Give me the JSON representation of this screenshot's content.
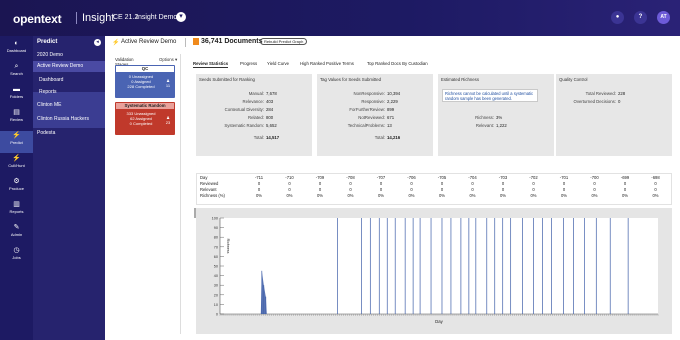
{
  "header": {
    "logo": "opentext",
    "product": "Insight",
    "version": "CE 21.2",
    "case_name": "Insight Demo",
    "chevron": "▾",
    "bell_icon": "●",
    "help_icon": "?",
    "avatar_initials": "AT"
  },
  "rail": [
    {
      "icon": "dashboard-icon",
      "glyph": "◐",
      "label": "Dashboard"
    },
    {
      "icon": "search-icon",
      "glyph": "⌕",
      "label": "Search"
    },
    {
      "icon": "folder-icon",
      "glyph": "▬",
      "label": "Folders"
    },
    {
      "icon": "review-icon",
      "glyph": "▤",
      "label": "Review"
    },
    {
      "icon": "predict-icon",
      "glyph": "⚡",
      "label": "Predict"
    },
    {
      "icon": "cull-icon",
      "glyph": "⚡",
      "label": "Cull/Hunt"
    },
    {
      "icon": "produce-icon",
      "glyph": "⚙",
      "label": "Produce"
    },
    {
      "icon": "reports-icon",
      "glyph": "▥",
      "label": "Reports"
    },
    {
      "icon": "admin-icon",
      "glyph": "✎",
      "label": "Admin"
    },
    {
      "icon": "jobs-icon",
      "glyph": "◷",
      "label": "Jobs"
    }
  ],
  "nav": {
    "title": "Predict",
    "back": "◂",
    "items": [
      {
        "label": "2020 Demo"
      },
      {
        "label": "Active Review Demo"
      },
      {
        "label": "Dashboard"
      },
      {
        "label": "Reports"
      },
      {
        "label": "Clinton ME"
      },
      {
        "label": "Clinton Russia Hackers"
      },
      {
        "label": "Podesta"
      }
    ]
  },
  "page": {
    "title": "Active Review Demo",
    "doc_count": "36,741 Documents",
    "rebuild_label": "Rebuild Predict Graph"
  },
  "stages": {
    "label": "Validation Stages",
    "options_label": "Options ▾",
    "qc": {
      "title": "QC",
      "lines": [
        "0 Unassigned",
        "0 Assigned",
        "228 Completed"
      ],
      "count": "11"
    },
    "sr": {
      "title": "Systematic Random",
      "lines": [
        "333 Unassigned",
        "62 Assigned",
        "0 Completed"
      ],
      "count": "23"
    }
  },
  "tabs": [
    "Review Statistics",
    "Progress",
    "Yield Curve",
    "High Ranked Positive Terms",
    "Top Ranked Docs By Custodian"
  ],
  "cards": {
    "seeds": {
      "title": "Seeds Submitted for Ranking",
      "rows": [
        {
          "k": "Manual:",
          "v": "7,678"
        },
        {
          "k": "Relevance:",
          "v": "403"
        },
        {
          "k": "Contextual Diversity:",
          "v": "284"
        },
        {
          "k": "Related:",
          "v": "800"
        },
        {
          "k": "Systematic Random:",
          "v": "5,652"
        }
      ],
      "total_k": "Total:",
      "total_v": "14,517"
    },
    "tags": {
      "title": "Tag Values for Seeds Submitted",
      "rows": [
        {
          "k": "NonResponsive:",
          "v": "10,394"
        },
        {
          "k": "Responsive:",
          "v": "2,229"
        },
        {
          "k": "ForFurtherReview:",
          "v": "899"
        },
        {
          "k": "NotReviewed:",
          "v": "671"
        },
        {
          "k": "TechnicalProblems:",
          "v": "13"
        }
      ],
      "total_k": "Total:",
      "total_v": "14,216"
    },
    "richness": {
      "title": "Estimated Richness",
      "notice": "Richness cannot be calculated until a systematic random sample has been generated.",
      "rows": [
        {
          "k": "Richness:",
          "v": "3%"
        },
        {
          "k": "Relevant:",
          "v": "1,222"
        }
      ]
    },
    "quality": {
      "title": "Quality Control",
      "rows": [
        {
          "k": "Total Reviewed:",
          "v": "228"
        },
        {
          "k": "Overturned Decisions:",
          "v": "0"
        }
      ]
    }
  },
  "day_table": {
    "row_labels": [
      "Day",
      "Reviewed",
      "Relevant",
      "Richness (%)"
    ],
    "days": [
      "-711",
      "-710",
      "-709",
      "-708",
      "-707",
      "-706",
      "-705",
      "-704",
      "-703",
      "-702",
      "-701",
      "-700",
      "-699",
      "-698"
    ],
    "reviewed": [
      "0",
      "0",
      "0",
      "0",
      "0",
      "0",
      "0",
      "0",
      "0",
      "0",
      "0",
      "0",
      "0",
      "0"
    ],
    "relevant": [
      "0",
      "0",
      "0",
      "0",
      "0",
      "0",
      "0",
      "0",
      "0",
      "0",
      "0",
      "0",
      "0",
      "0"
    ],
    "richness": [
      "0%",
      "0%",
      "0%",
      "0%",
      "0%",
      "0%",
      "0%",
      "0%",
      "0%",
      "0%",
      "0%",
      "0%",
      "0%",
      "0%"
    ]
  },
  "chart_data": {
    "type": "bar",
    "xlabel": "Day",
    "ylabel": "Richness",
    "ylim": [
      0,
      100
    ],
    "yticks": [
      0,
      10,
      20,
      30,
      40,
      50,
      60,
      70,
      80,
      90,
      100
    ],
    "x_count": 440,
    "bars": [
      {
        "x": 42,
        "y": 45
      },
      {
        "x": 44,
        "y": 30
      },
      {
        "x": 46,
        "y": 18
      },
      {
        "x": 118,
        "y": 100
      },
      {
        "x": 142,
        "y": 100
      },
      {
        "x": 151,
        "y": 100
      },
      {
        "x": 160,
        "y": 100
      },
      {
        "x": 168,
        "y": 100
      },
      {
        "x": 176,
        "y": 100
      },
      {
        "x": 186,
        "y": 100
      },
      {
        "x": 194,
        "y": 100
      },
      {
        "x": 201,
        "y": 100
      },
      {
        "x": 212,
        "y": 100
      },
      {
        "x": 223,
        "y": 100
      },
      {
        "x": 232,
        "y": 100
      },
      {
        "x": 242,
        "y": 100
      },
      {
        "x": 250,
        "y": 100
      },
      {
        "x": 257,
        "y": 100
      },
      {
        "x": 268,
        "y": 100
      },
      {
        "x": 276,
        "y": 100
      },
      {
        "x": 284,
        "y": 100
      },
      {
        "x": 292,
        "y": 100
      },
      {
        "x": 304,
        "y": 100
      },
      {
        "x": 315,
        "y": 100
      },
      {
        "x": 324,
        "y": 100
      },
      {
        "x": 333,
        "y": 100
      },
      {
        "x": 345,
        "y": 100
      },
      {
        "x": 355,
        "y": 100
      },
      {
        "x": 366,
        "y": 100
      },
      {
        "x": 378,
        "y": 100
      },
      {
        "x": 392,
        "y": 100
      },
      {
        "x": 410,
        "y": 100
      }
    ]
  },
  "colors": {
    "brand": "#1d1a63",
    "qc_blue": "#4a64b3",
    "sr_red": "#c0392b",
    "bar": "#3e5ea8"
  }
}
